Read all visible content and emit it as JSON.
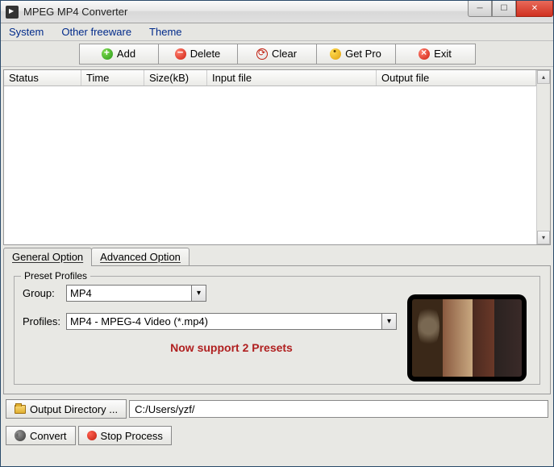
{
  "window": {
    "title": "MPEG MP4 Converter"
  },
  "menu": {
    "system": "System",
    "freeware": "Other freeware",
    "theme": "Theme"
  },
  "toolbar": {
    "add": "Add",
    "delete": "Delete",
    "clear": "Clear",
    "getpro": "Get Pro",
    "exit": "Exit"
  },
  "list": {
    "columns": {
      "status": "Status",
      "time": "Time",
      "size": "Size(kB)",
      "input": "Input file",
      "output": "Output file"
    }
  },
  "tabs": {
    "general": "General Option",
    "advanced": "Advanced Option"
  },
  "preset": {
    "legend": "Preset Profiles",
    "group_label": "Group:",
    "group_value": "MP4",
    "profiles_label": "Profiles:",
    "profiles_value": "MP4 - MPEG-4 Video (*.mp4)",
    "support_text": "Now support 2 Presets"
  },
  "output": {
    "button": "Output Directory ...",
    "path": "C:/Users/yzf/"
  },
  "footer": {
    "convert": "Convert",
    "stop": "Stop Process"
  }
}
